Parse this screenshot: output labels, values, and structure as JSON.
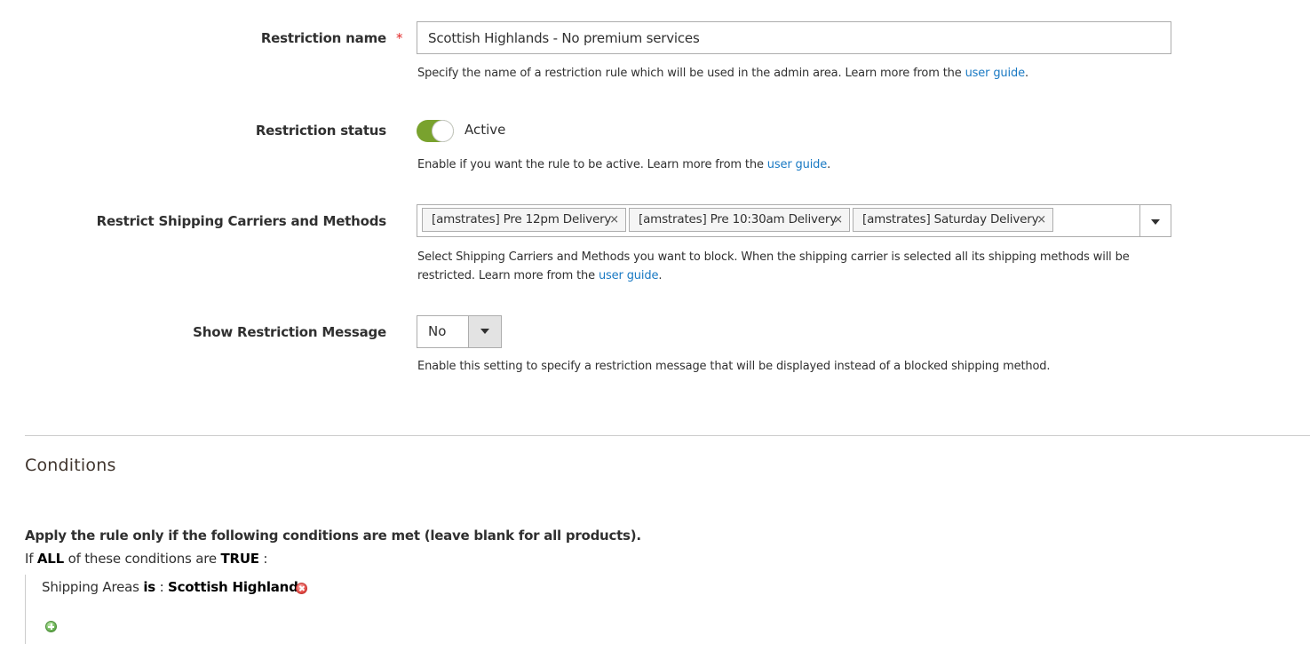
{
  "restriction_name": {
    "label": "Restriction name",
    "required_mark": "*",
    "value": "Scottish Highlands - No premium services",
    "note_text": "Specify the name of a restriction rule which will be used in the admin area. Learn more from the ",
    "note_link": "user guide",
    "note_end": "."
  },
  "restriction_status": {
    "label": "Restriction status",
    "toggle_state": "on",
    "toggle_label": "Active",
    "note_text": "Enable if you want the rule to be active. Learn more from the ",
    "note_link": "user guide",
    "note_end": "."
  },
  "shipping_methods": {
    "label": "Restrict Shipping Carriers and Methods",
    "chips": [
      {
        "label": "[amstrates] Pre 12pm Delivery",
        "remove": "×"
      },
      {
        "label": "[amstrates] Pre 10:30am Delivery",
        "remove": "×"
      },
      {
        "label": "[amstrates] Saturday Delivery",
        "remove": "×"
      }
    ],
    "note_line1": "Select Shipping Carriers and Methods you want to block. When the shipping carrier is selected all its shipping methods will be",
    "note_line2_text": "restricted. Learn more from the ",
    "note_link": "user guide",
    "note_end": "."
  },
  "restriction_message": {
    "label": "Show Restriction Message",
    "selected_value": "No",
    "note_text": "Enable this setting to specify a restriction message that will be displayed instead of a blocked shipping method."
  },
  "conditions": {
    "section_title": "Conditions",
    "heading": "Apply the rule only if the following conditions are met (leave blank for all products).",
    "if_prefix": "If",
    "aggregator": "ALL",
    "middle_text": " of these conditions are",
    "value": "TRUE",
    "suffix": " :",
    "item": {
      "attribute": "Shipping Areas",
      "operator": "is",
      "separator": " :",
      "value": "Scottish Highlands"
    }
  },
  "colors": {
    "toggle_on": "#79a22e",
    "link": "#1979c3",
    "required": "#e22626",
    "remove_icon": "#e0413c",
    "add_icon": "#5da948"
  },
  "icons": {
    "remove_condition": "remove-circle-icon",
    "add_condition": "add-circle-icon",
    "dropdown": "caret-down-icon"
  }
}
